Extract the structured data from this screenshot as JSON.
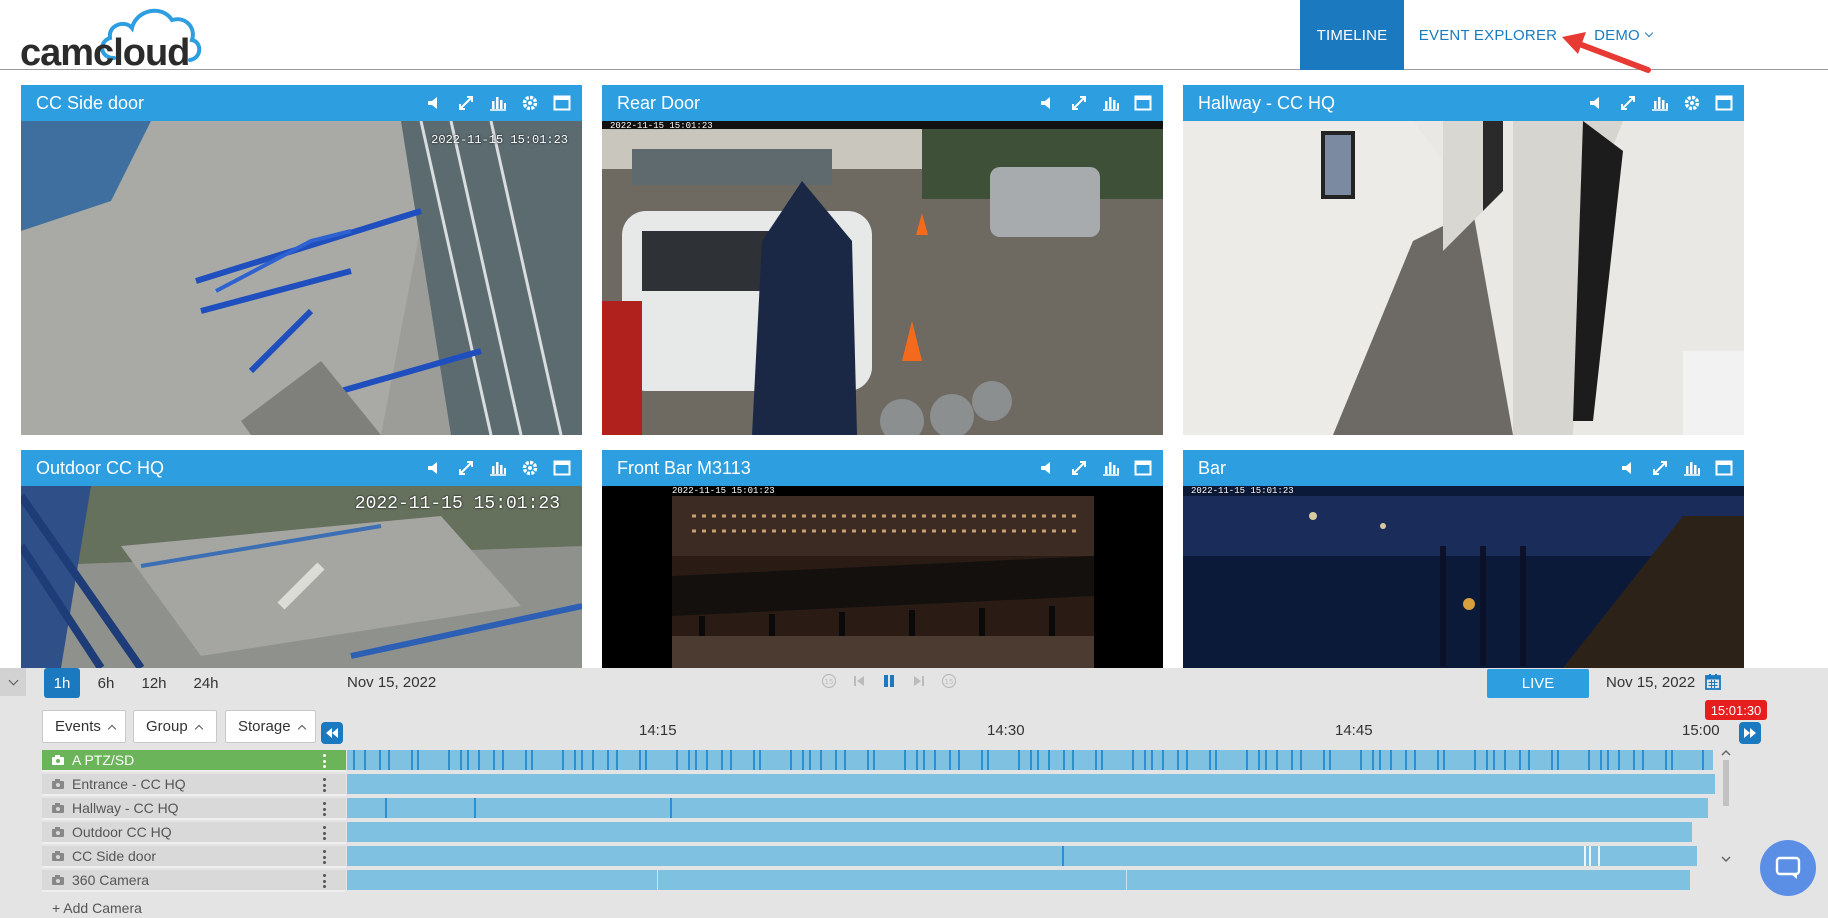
{
  "header": {
    "logo": "camcloud",
    "nav": [
      {
        "label": "TIMELINE",
        "active": true
      },
      {
        "label": "EVENT EXPLORER",
        "active": false
      },
      {
        "label": "DEMO",
        "active": false,
        "dropdown": true
      }
    ]
  },
  "cameras": [
    {
      "title": "CC Side door",
      "timestamp": "2022-11-15 15:01:23"
    },
    {
      "title": "Rear Door",
      "timestamp": "2022-11-15 15:01:23"
    },
    {
      "title": "Hallway - CC HQ",
      "timestamp": ""
    },
    {
      "title": "Outdoor CC HQ",
      "timestamp": "2022-11-15 15:01:23"
    },
    {
      "title": "Front Bar M3113",
      "timestamp": "2022-11-15 15:01:23"
    },
    {
      "title": "Bar",
      "timestamp": "2022-11-15 15:01:23"
    }
  ],
  "timeline": {
    "ranges": [
      {
        "label": "1h",
        "active": true
      },
      {
        "label": "6h",
        "active": false
      },
      {
        "label": "12h",
        "active": false
      },
      {
        "label": "24h",
        "active": false
      }
    ],
    "date_left": "Nov 15, 2022",
    "live_label": "LIVE",
    "date_right": "Nov 15, 2022",
    "filters": [
      "Events",
      "Group",
      "Storage"
    ],
    "ticks": [
      "14:15",
      "14:30",
      "14:45",
      "15:00"
    ],
    "now_label": "15:01:30",
    "rows": [
      {
        "name": "A PTZ/SD",
        "selected": true
      },
      {
        "name": "Entrance - CC HQ",
        "selected": false
      },
      {
        "name": "Hallway - CC HQ",
        "selected": false
      },
      {
        "name": "Outdoor CC HQ",
        "selected": false
      },
      {
        "name": "CC Side door",
        "selected": false
      },
      {
        "name": "360 Camera",
        "selected": false
      }
    ],
    "add_camera": "+ Add Camera"
  },
  "colors": {
    "tile_bar": "#2d9ee0",
    "nav_active": "#1b79c0",
    "selected_row": "#6cb45a",
    "lane": "#7fc1e0",
    "now_marker": "#e61e1e"
  }
}
